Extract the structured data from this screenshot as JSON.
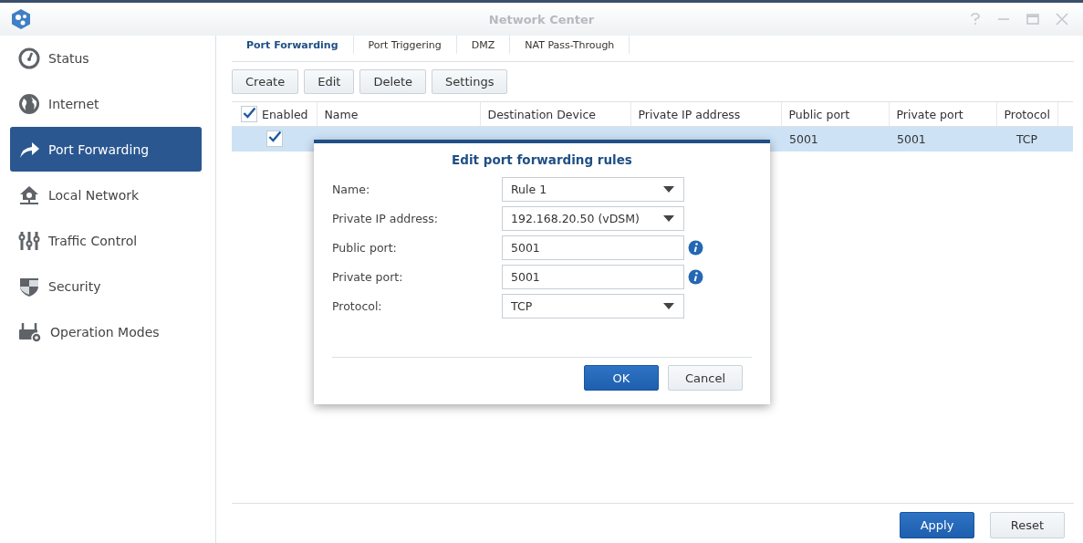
{
  "window": {
    "title": "Network Center"
  },
  "sidebar": {
    "items": [
      {
        "label": "Status",
        "selected": false
      },
      {
        "label": "Internet",
        "selected": false
      },
      {
        "label": "Port Forwarding",
        "selected": true
      },
      {
        "label": "Local Network",
        "selected": false
      },
      {
        "label": "Traffic Control",
        "selected": false
      },
      {
        "label": "Security",
        "selected": false
      },
      {
        "label": "Operation Modes",
        "selected": false
      }
    ]
  },
  "tabs": [
    {
      "label": "Port Forwarding",
      "selected": true
    },
    {
      "label": "Port Triggering",
      "selected": false
    },
    {
      "label": "DMZ",
      "selected": false
    },
    {
      "label": "NAT Pass-Through",
      "selected": false
    }
  ],
  "toolbar": [
    "Create",
    "Edit",
    "Delete",
    "Settings"
  ],
  "table": {
    "header_checked": true,
    "columns": [
      "Enabled",
      "Name",
      "Destination Device",
      "Private IP address",
      "Public port",
      "Private port",
      "Protocol"
    ],
    "rows": [
      {
        "checked": true,
        "selected": true,
        "cells": [
          "",
          "",
          "",
          "",
          "5001",
          "5001",
          "TCP"
        ]
      }
    ]
  },
  "dialog": {
    "title": "Edit port forwarding rules",
    "fields": [
      {
        "kind": "select",
        "label": "Name:",
        "value": "Rule 1"
      },
      {
        "kind": "select",
        "label": "Private IP address:",
        "value": "192.168.20.50 (vDSM)"
      },
      {
        "kind": "text",
        "label": "Public port:",
        "value": "5001"
      },
      {
        "kind": "text",
        "label": "Private port:",
        "value": "5001"
      },
      {
        "kind": "select",
        "label": "Protocol:",
        "value": "TCP"
      }
    ],
    "buttons": [
      {
        "label": "OK",
        "primary": true
      },
      {
        "label": "Cancel",
        "primary": false
      }
    ]
  },
  "footer_buttons": [
    {
      "label": "Apply",
      "primary": true
    },
    {
      "label": "Reset",
      "primary": false
    }
  ]
}
